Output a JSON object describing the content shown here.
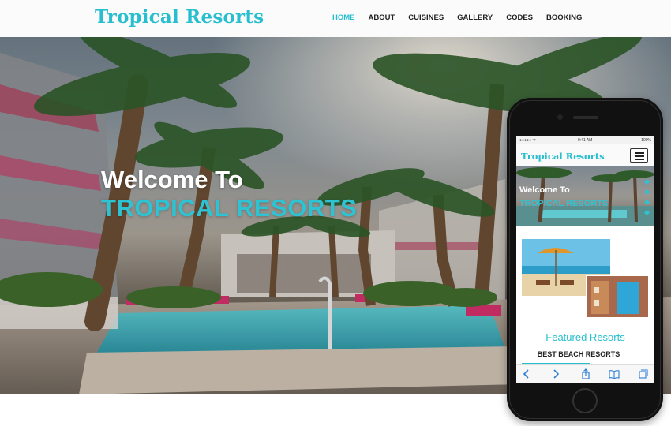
{
  "header": {
    "logo": "Tropical Resorts",
    "nav": [
      {
        "label": "HOME",
        "active": true
      },
      {
        "label": "ABOUT",
        "active": false
      },
      {
        "label": "CUISINES",
        "active": false
      },
      {
        "label": "GALLERY",
        "active": false
      },
      {
        "label": "CODES",
        "active": false
      },
      {
        "label": "BOOKING",
        "active": false
      }
    ]
  },
  "hero": {
    "line1": "Welcome To",
    "line2": "TROPICAL RESORTS"
  },
  "mobile": {
    "status": {
      "left": "●●●●● ᯤ",
      "time": "9:41 AM",
      "right": "100%"
    },
    "logo": "Tropical Resorts",
    "hero_line1": "Welcome To",
    "hero_line2": "TROPICAL RESORTS",
    "featured_title": "Featured Resorts",
    "featured_subtitle": "BEST BEACH RESORTS",
    "toolbar_icons": [
      "back-icon",
      "forward-icon",
      "share-icon",
      "bookmarks-icon",
      "tabs-icon"
    ]
  },
  "colors": {
    "accent": "#27bfcf",
    "nav_text": "#222222",
    "hero_white": "#ffffff"
  }
}
